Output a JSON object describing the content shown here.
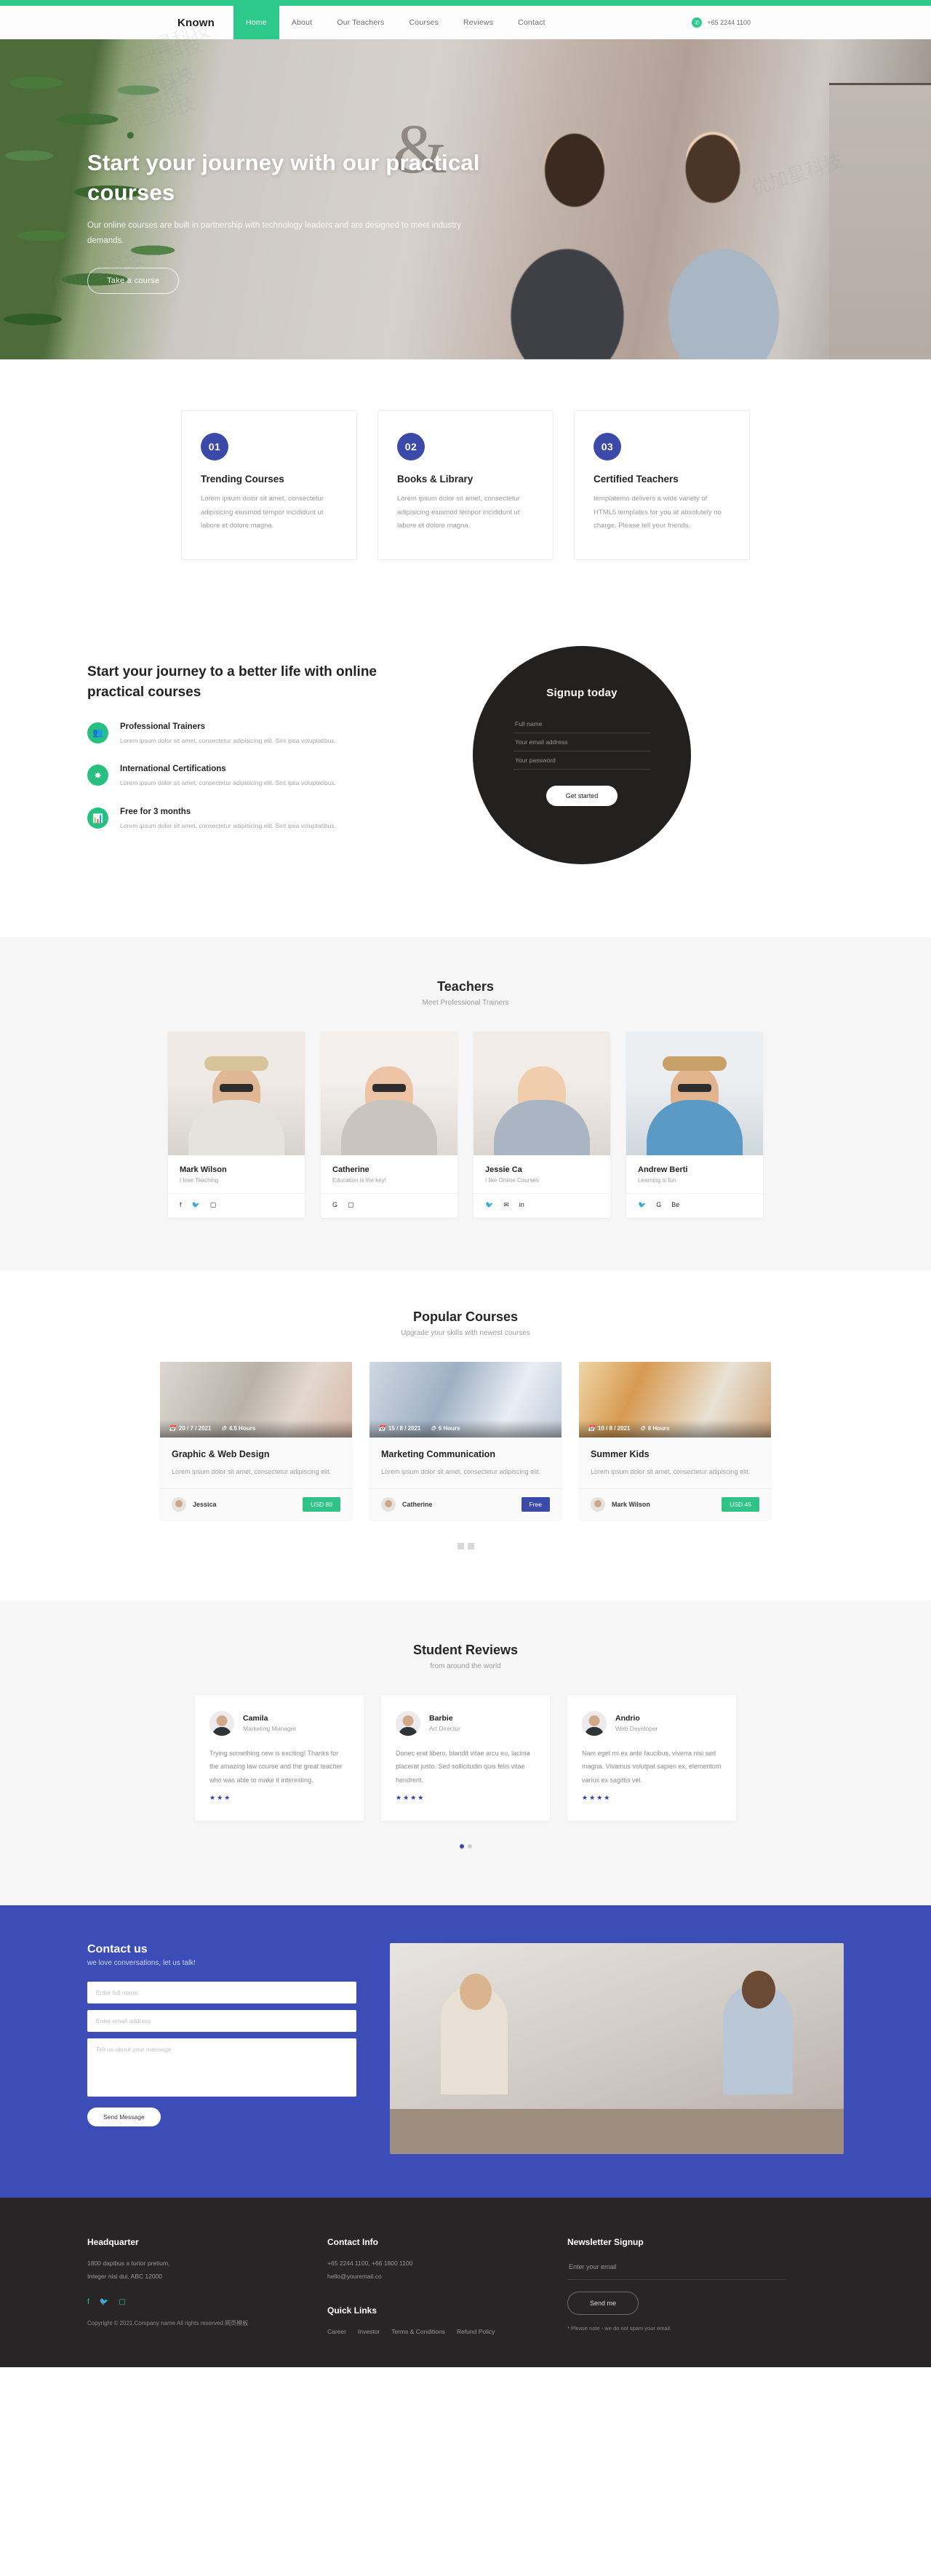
{
  "header": {
    "brand": "Known",
    "nav": [
      {
        "label": "Home",
        "active": true
      },
      {
        "label": "About",
        "active": false
      },
      {
        "label": "Our Teachers",
        "active": false
      },
      {
        "label": "Courses",
        "active": false
      },
      {
        "label": "Reviews",
        "active": false
      },
      {
        "label": "Contact",
        "active": false
      }
    ],
    "whatsapp_icon": "whatsapp-icon",
    "phone": "+65 2244 1100"
  },
  "hero": {
    "title": "Start your journey with our practical courses",
    "subtitle": "Our online courses are built in partnership with technology leaders and are designed to meet industry demands.",
    "button": "Take a course"
  },
  "features": [
    {
      "number": "01",
      "title": "Trending Courses",
      "text": "Lorem ipsum dolor sit amet, consectetur adipisicing eiusmod tempor incididunt ut labore et dolore magna."
    },
    {
      "number": "02",
      "title": "Books & Library",
      "text": "Lorem ipsum dolor sit amet, consectetur adipisicing eiusmod tempor incididunt ut labore et dolore magna."
    },
    {
      "number": "03",
      "title": "Certified Teachers",
      "text": "templatemo delivers a wide variety of HTML5 templates for you at absolutely no charge. Please tell your friends."
    }
  ],
  "journey": {
    "title": "Start your journey to a better life with online practical courses",
    "items": [
      {
        "icon": "users-icon",
        "title": "Professional Trainers",
        "text": "Lorem ipsum dolor sit amet, consectetur adipisicing elit. Sint ipsa voluptatibus."
      },
      {
        "icon": "certificate-icon",
        "title": "International Certifications",
        "text": "Lorem ipsum dolor sit amet, consectetur adipisicing elit. Sint ipsa voluptatibus."
      },
      {
        "icon": "chart-icon",
        "title": "Free for 3 months",
        "text": "Lorem ipsum dolor sit amet, consectetur adipisicing elit. Sint ipsa voluptatibus."
      }
    ],
    "signup": {
      "title": "Signup today",
      "fields": [
        {
          "placeholder": "Full name",
          "value": ""
        },
        {
          "placeholder": "Your email address",
          "value": ""
        },
        {
          "placeholder": "Your password",
          "value": ""
        }
      ],
      "button": "Get started"
    }
  },
  "teachers": {
    "heading": "Teachers",
    "subheading": "Meet Professional Trainers",
    "list": [
      {
        "name": "Mark Wilson",
        "role": "I love Teaching",
        "socials": [
          "facebook-icon",
          "twitter-icon",
          "instagram-icon"
        ]
      },
      {
        "name": "Catherine",
        "role": "Education is the key!",
        "socials": [
          "google-icon",
          "instagram-icon"
        ]
      },
      {
        "name": "Jessie Ca",
        "role": "I like Online Courses",
        "socials": [
          "twitter-icon",
          "email-icon",
          "linkedin-icon"
        ]
      },
      {
        "name": "Andrew Berti",
        "role": "Learning is fun",
        "socials": [
          "twitter-icon",
          "google-icon",
          "behance-icon"
        ]
      }
    ]
  },
  "courses": {
    "heading": "Popular Courses",
    "subheading": "Upgrade your skills with newest courses",
    "list": [
      {
        "date": "20 / 7 / 2021",
        "duration": "4.5 Hours",
        "title": "Graphic & Web Design",
        "text": "Lorem ipsum dolor sit amet, consectetur adipiscing elit.",
        "author": "Jessica",
        "price": "USD 80",
        "price_color": "#2fc486"
      },
      {
        "date": "15 / 8 / 2021",
        "duration": "6 Hours",
        "title": "Marketing Communication",
        "text": "Lorem ipsum dolor sit amet, consectetur adipiscing elit.",
        "author": "Catherine",
        "price": "Free",
        "price_color": "#3b49a8"
      },
      {
        "date": "10 / 8 / 2021",
        "duration": "8 Hours",
        "title": "Summer Kids",
        "text": "Lorem ipsum dolor sit amet, consectetur adipiscing elit.",
        "author": "Mark Wilson",
        "price": "USD 45",
        "price_color": "#2fc486"
      }
    ],
    "pagination": [
      "1",
      "2"
    ]
  },
  "reviews": {
    "heading": "Student Reviews",
    "subheading": "from around the world",
    "list": [
      {
        "name": "Camila",
        "role": "Marketing Manager",
        "text": "Trying something new is exciting! Thanks for the amazing law course and the great teacher who was able to make it interesting.",
        "stars": "★★★"
      },
      {
        "name": "Barbie",
        "role": "Art Director",
        "text": "Donec erat libero, blandit vitae arcu eu, lacinia placerat justo. Sed sollicitudin quis felis vitae hendrerit.",
        "stars": "★★★★"
      },
      {
        "name": "Andrio",
        "role": "Web Developer",
        "text": "Nam eget mi ex ante faucibus, viverra nisi sed magna. Vivamus volutpat sapien ex, elementum varius ex sagittis vel.",
        "stars": "★★★★"
      }
    ]
  },
  "contact": {
    "title": "Contact us",
    "subtitle": "we love conversations, let us talk!",
    "fields": [
      {
        "placeholder": "Enter full name",
        "value": ""
      },
      {
        "placeholder": "Enter email address",
        "value": ""
      }
    ],
    "message_placeholder": "Tell us about your message",
    "button": "Send Message"
  },
  "footer": {
    "headquarter": {
      "title": "Headquarter",
      "line1": "1800 dapibus a tortor pretium,",
      "line2": "Integer nisl dui, ABC 12000",
      "socials": [
        "facebook-icon",
        "twitter-icon",
        "instagram-icon"
      ],
      "copyright": "Copyright © 2021.Company name All rights reserved.网页模板"
    },
    "contact_info": {
      "title": "Contact Info",
      "phones": "+65 2244 1100, +66 1800 1100",
      "email": "hello@youremail.co"
    },
    "quick_links": {
      "title": "Quick Links",
      "links": [
        "Career",
        "Investor",
        "Terms & Conditions",
        "Refund Policy"
      ]
    },
    "newsletter": {
      "title": "Newsletter Signup",
      "placeholder": "Enter your email",
      "button": "Send me",
      "note": "* Please note - we do not spam your email."
    }
  }
}
